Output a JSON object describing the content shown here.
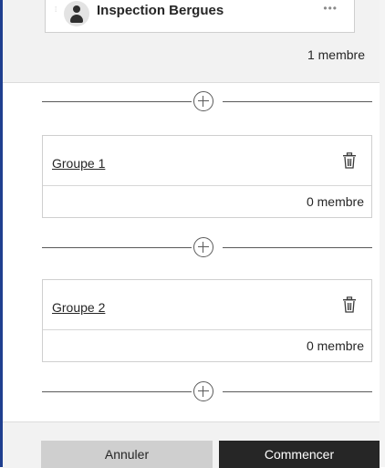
{
  "member": {
    "name": "Inspection Bergues",
    "more": "•••",
    "count": "1 membre"
  },
  "groups": [
    {
      "name": "Groupe 1",
      "count": "0 membre"
    },
    {
      "name": "Groupe 2",
      "count": "0 membre"
    }
  ],
  "footer": {
    "cancel_label": "Annuler",
    "start_label": "Commencer"
  },
  "icons": {
    "add": "plus-circle-icon",
    "delete": "trash-icon",
    "avatar": "user-icon",
    "more": "ellipsis-icon"
  },
  "colors": {
    "accent": "#1f3f8f",
    "primary_button": "#262626",
    "secondary_button": "#cfcfcf"
  }
}
